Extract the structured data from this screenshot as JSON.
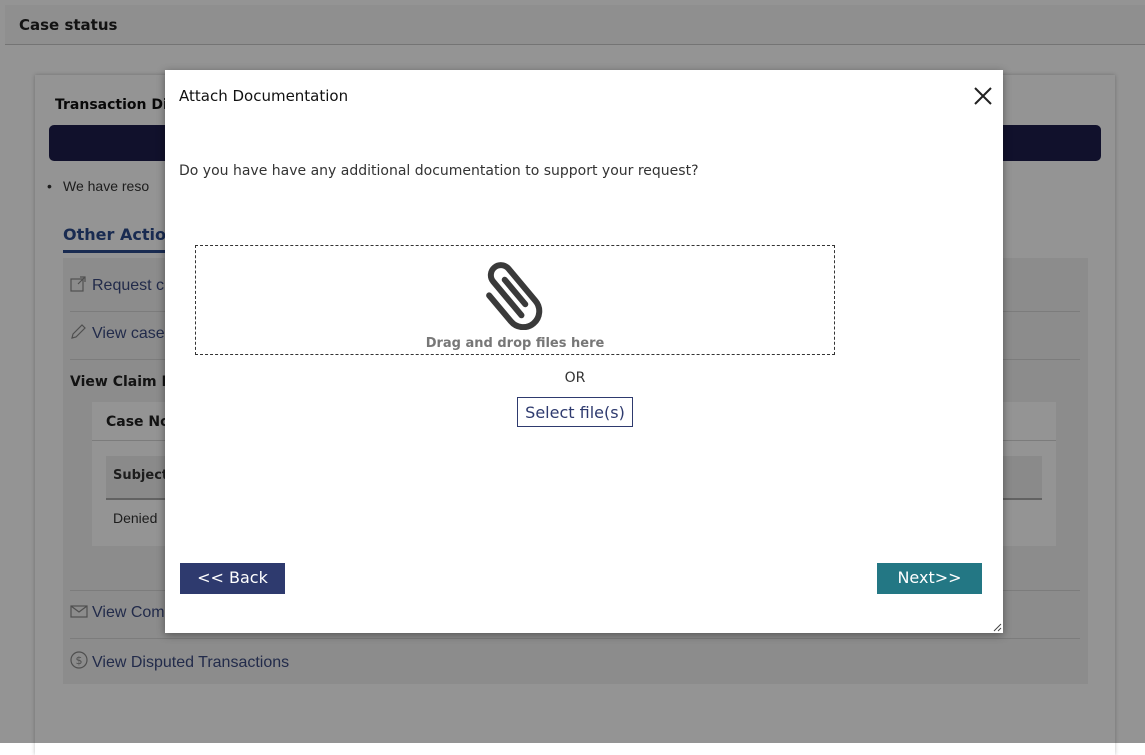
{
  "header": {
    "title": "Case status"
  },
  "page": {
    "section_title": "Transaction Dis",
    "bullet_text": "We have reso",
    "tab_label": "Other Actio",
    "actions": [
      {
        "icon": "external-link-icon",
        "label": "Request c"
      },
      {
        "icon": "pencil-icon",
        "label": "View case"
      }
    ],
    "claim_title": "View Claim D",
    "notes": {
      "title": "Case No",
      "column_header": "Subject",
      "cell": "Denied"
    },
    "bottom_actions": [
      {
        "icon": "envelope-icon",
        "label": "View Com"
      },
      {
        "icon": "dollar-circle-icon",
        "label": "View Disputed Transactions"
      }
    ]
  },
  "modal": {
    "title": "Attach Documentation",
    "question": "Do you have have any additional documentation to support your request?",
    "dropzone_label": "Drag and drop files here",
    "or_label": "OR",
    "select_button": "Select file(s)",
    "back_button": "<< Back",
    "next_button": "Next>>"
  },
  "colors": {
    "primary": "#2e3a6e",
    "next": "#237784",
    "banner": "#1e1e4c",
    "overlay": "rgba(0,0,0,0.42)"
  }
}
